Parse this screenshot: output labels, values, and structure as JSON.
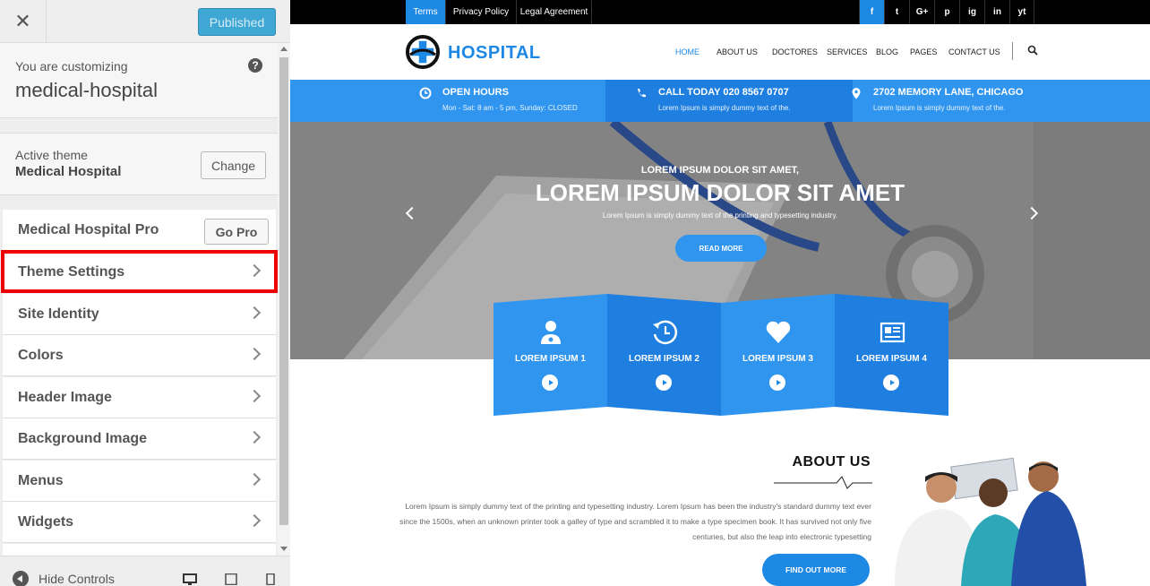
{
  "sidebar": {
    "close_label": "✕",
    "published_label": "Published",
    "customizing_label": "You are customizing",
    "site_name": "medical-hospital",
    "help_label": "?",
    "active_theme_label": "Active theme",
    "active_theme_name": "Medical Hospital",
    "change_label": "Change",
    "pro_label": "Medical Hospital Pro",
    "go_pro_label": "Go Pro",
    "items": [
      {
        "label": "Theme Settings"
      },
      {
        "label": "Site Identity"
      },
      {
        "label": "Colors"
      },
      {
        "label": "Header Image"
      },
      {
        "label": "Background Image"
      },
      {
        "label": "Menus"
      },
      {
        "label": "Widgets"
      }
    ],
    "hide_controls_label": "Hide Controls"
  },
  "preview": {
    "top_links": [
      "Terms",
      "Privacy Policy",
      "Legal Agreement"
    ],
    "social": [
      "f",
      "t",
      "G+",
      "p",
      "ig",
      "in",
      "yt"
    ],
    "logo_text": "HOSPITAL",
    "nav": [
      "HOME",
      "ABOUT US",
      "DOCTORES",
      "SERVICES",
      "BLOG",
      "PAGES",
      "CONTACT US"
    ],
    "info": [
      {
        "title": "OPEN HOURS",
        "sub": "Mon - Sat: 8 am - 5 pm, Sunday: CLOSED"
      },
      {
        "title": "CALL TODAY 020 8567 0707",
        "sub": "Lorem Ipsum is simply dummy text of the."
      },
      {
        "title": "2702 MEMORY LANE, CHICAGO",
        "sub": "Lorem Ipsum is simply dummy text of the."
      }
    ],
    "hero": {
      "subtitle": "LOREM IPSUM DOLOR SIT AMET,",
      "title": "LOREM IPSUM DOLOR SIT AMET",
      "desc": "Lorem Ipsum is simply dummy text of the printing and typesetting industry.",
      "button": "READ MORE"
    },
    "features": [
      {
        "title": "LOREM IPSUM 1"
      },
      {
        "title": "LOREM IPSUM 2"
      },
      {
        "title": "LOREM IPSUM 3"
      },
      {
        "title": "LOREM IPSUM 4"
      }
    ],
    "about": {
      "title": "ABOUT US",
      "text": "Lorem Ipsum is simply dummy text of the printing and typesetting industry. Lorem Ipsum has been the industry's standard dummy text ever since the 1500s, when an unknown printer took a galley of type and scrambled it to make a type specimen book. It has survived not only five centuries, but also the leap into electronic typesetting",
      "button": "FIND OUT MORE"
    }
  },
  "colors": {
    "accent": "#1e88e5",
    "published_bg": "#3fa7d4",
    "highlight": "#ee0000"
  }
}
